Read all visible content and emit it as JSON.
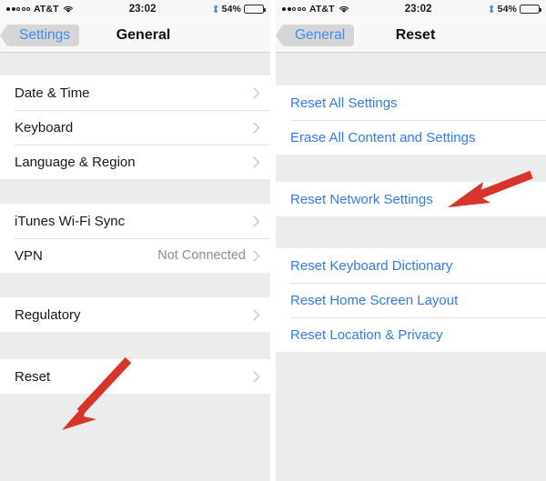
{
  "screens": [
    {
      "id": "general",
      "statusbar": {
        "carrier": "AT&T",
        "signal_filled": 2,
        "signal_hollow": 3,
        "wifi_icon": "wifi-icon",
        "time": "23:02",
        "bluetooth_icon": "bluetooth-icon",
        "battery_percent": "54%",
        "battery_level": 54
      },
      "nav": {
        "back_label": "Settings",
        "title": "General"
      },
      "groups": [
        {
          "rows": [
            {
              "label": "Date & Time",
              "value": "",
              "style": "default",
              "chevron": true
            },
            {
              "label": "Keyboard",
              "value": "",
              "style": "default",
              "chevron": true
            },
            {
              "label": "Language & Region",
              "value": "",
              "style": "default",
              "chevron": true
            }
          ]
        },
        {
          "rows": [
            {
              "label": "iTunes Wi-Fi Sync",
              "value": "",
              "style": "default",
              "chevron": true
            },
            {
              "label": "VPN",
              "value": "Not Connected",
              "style": "default",
              "chevron": true
            }
          ]
        },
        {
          "rows": [
            {
              "label": "Regulatory",
              "value": "",
              "style": "default",
              "chevron": true
            }
          ]
        },
        {
          "rows": [
            {
              "label": "Reset",
              "value": "",
              "style": "default",
              "chevron": true
            }
          ]
        }
      ]
    },
    {
      "id": "reset",
      "statusbar": {
        "carrier": "AT&T",
        "signal_filled": 2,
        "signal_hollow": 3,
        "wifi_icon": "wifi-icon",
        "time": "23:02",
        "bluetooth_icon": "bluetooth-icon",
        "battery_percent": "54%",
        "battery_level": 54
      },
      "nav": {
        "back_label": "General",
        "title": "Reset"
      },
      "groups": [
        {
          "rows": [
            {
              "label": "Reset All Settings",
              "value": "",
              "style": "link",
              "chevron": false
            },
            {
              "label": "Erase All Content and Settings",
              "value": "",
              "style": "link",
              "chevron": false
            }
          ]
        },
        {
          "rows": [
            {
              "label": "Reset Network Settings",
              "value": "",
              "style": "link",
              "chevron": false
            }
          ]
        },
        {
          "rows": [
            {
              "label": "Reset Keyboard Dictionary",
              "value": "",
              "style": "link",
              "chevron": false
            },
            {
              "label": "Reset Home Screen Layout",
              "value": "",
              "style": "link",
              "chevron": false
            },
            {
              "label": "Reset Location & Privacy",
              "value": "",
              "style": "link",
              "chevron": false
            }
          ]
        }
      ]
    }
  ],
  "annotations": {
    "arrow_color": "#d8342a",
    "arrows": [
      {
        "name": "arrow-to-reset",
        "target": "Reset"
      },
      {
        "name": "arrow-to-reset-network-settings",
        "target": "Reset Network Settings"
      }
    ]
  },
  "colors": {
    "accent_blue": "#2f7cf6",
    "back_blue": "#3b8cf5",
    "page_bg": "#ececed",
    "row_bg": "#ffffff",
    "value_gray": "#8e8e93",
    "arrow_red": "#d8342a"
  }
}
